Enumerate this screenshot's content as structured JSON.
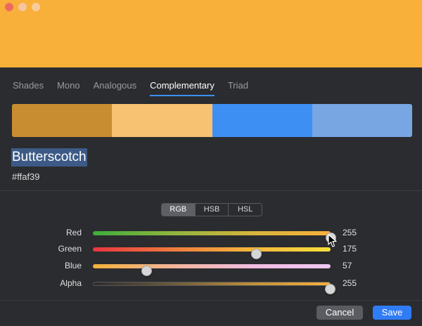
{
  "preview": {
    "color": "#f8b03a"
  },
  "tabs": [
    {
      "label": "Shades",
      "active": false
    },
    {
      "label": "Mono",
      "active": false
    },
    {
      "label": "Analogous",
      "active": false
    },
    {
      "label": "Complementary",
      "active": true
    },
    {
      "label": "Triad",
      "active": false
    }
  ],
  "swatches": [
    "#c98d31",
    "#f7c272",
    "#3d8ff4",
    "#77a6e3"
  ],
  "color": {
    "name": "Butterscotch",
    "hex": "#ffaf39"
  },
  "modes": [
    {
      "label": "RGB",
      "active": true
    },
    {
      "label": "HSB",
      "active": false
    },
    {
      "label": "HSL",
      "active": false
    }
  ],
  "sliders": [
    {
      "label": "Red",
      "value": "255",
      "fraction": 1.0
    },
    {
      "label": "Green",
      "value": "175",
      "fraction": 0.686
    },
    {
      "label": "Blue",
      "value": "57",
      "fraction": 0.224
    },
    {
      "label": "Alpha",
      "value": "255",
      "fraction": 1.0
    }
  ],
  "buttons": {
    "cancel": "Cancel",
    "save": "Save"
  }
}
